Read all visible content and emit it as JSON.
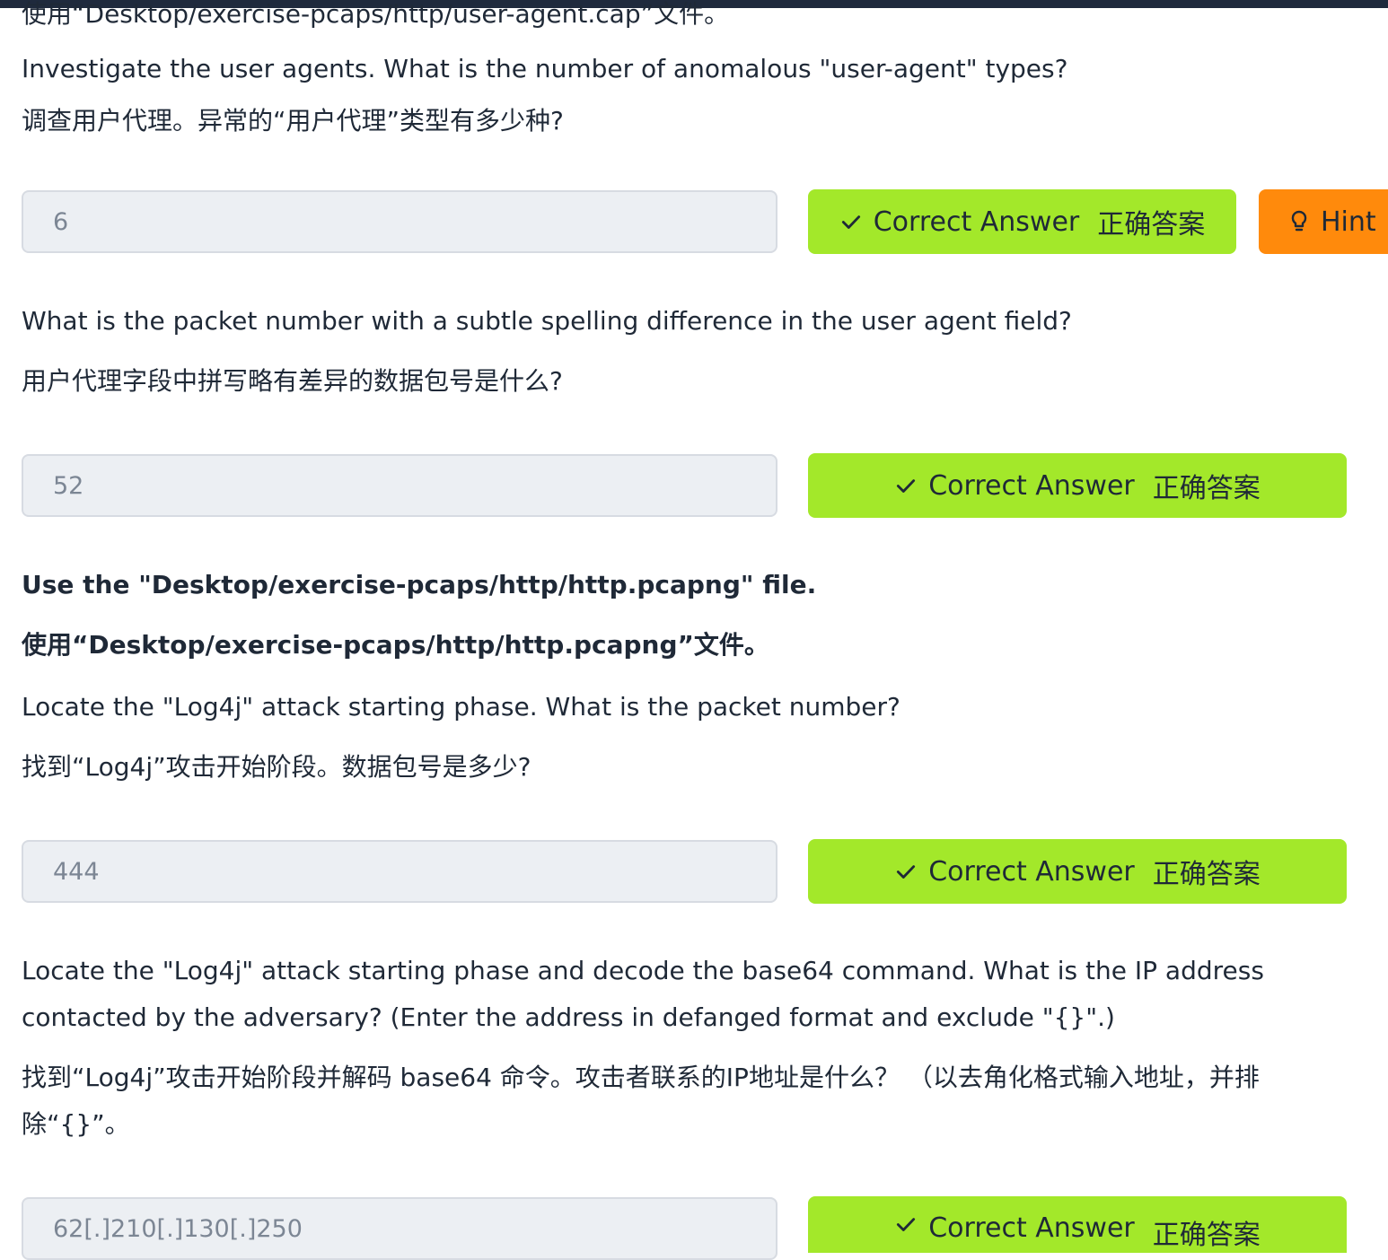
{
  "q1": {
    "file_line_zh_partial": "使用“Desktop/exercise-pcaps/http/user-agent.cap”文件。",
    "question_en": "Investigate the user agents. What is the number of anomalous  \"user-agent\" types?",
    "question_zh": "调查用户代理。异常的“用户代理”类型有多少种?",
    "answer": "6",
    "correct_en": "Correct Answer",
    "correct_zh": "正确答案",
    "hint_label": "Hint"
  },
  "q2": {
    "question_en": "What is the packet number with a subtle spelling difference in the user agent field?",
    "question_zh": "用户代理字段中拼写略有差异的数据包号是什么?",
    "answer": "52",
    "correct_en": "Correct Answer",
    "correct_zh": "正确答案"
  },
  "section2": {
    "file_en": "Use the \"Desktop/exercise-pcaps/http/http.pcapng\" file.",
    "file_zh": "使用“Desktop/exercise-pcaps/http/http.pcapng”文件。"
  },
  "q3": {
    "question_en": "Locate the \"Log4j\" attack starting phase. What is the packet number?",
    "question_zh": "找到“Log4j”攻击开始阶段。数据包号是多少?",
    "answer": "444",
    "correct_en": "Correct Answer",
    "correct_zh": "正确答案"
  },
  "q4": {
    "question_en": "Locate the \"Log4j\" attack starting phase and decode the base64 command. What is the IP address contacted by the adversary? (Enter the address in defanged format and exclude \"{}\".)",
    "question_zh": "找到“Log4j”攻击开始阶段并解码 base64 命令。攻击者联系的IP地址是什么？ （以去角化格式输入地址，并排除“{}”。",
    "answer": "62[.]210[.]130[.]250",
    "correct_en": "Correct Answer",
    "correct_zh": "正确答案"
  },
  "colors": {
    "correct_bg": "#a3e82a",
    "hint_bg": "#ff8a0c",
    "field_bg": "#eceff3",
    "topbar": "#1f2a3d"
  }
}
